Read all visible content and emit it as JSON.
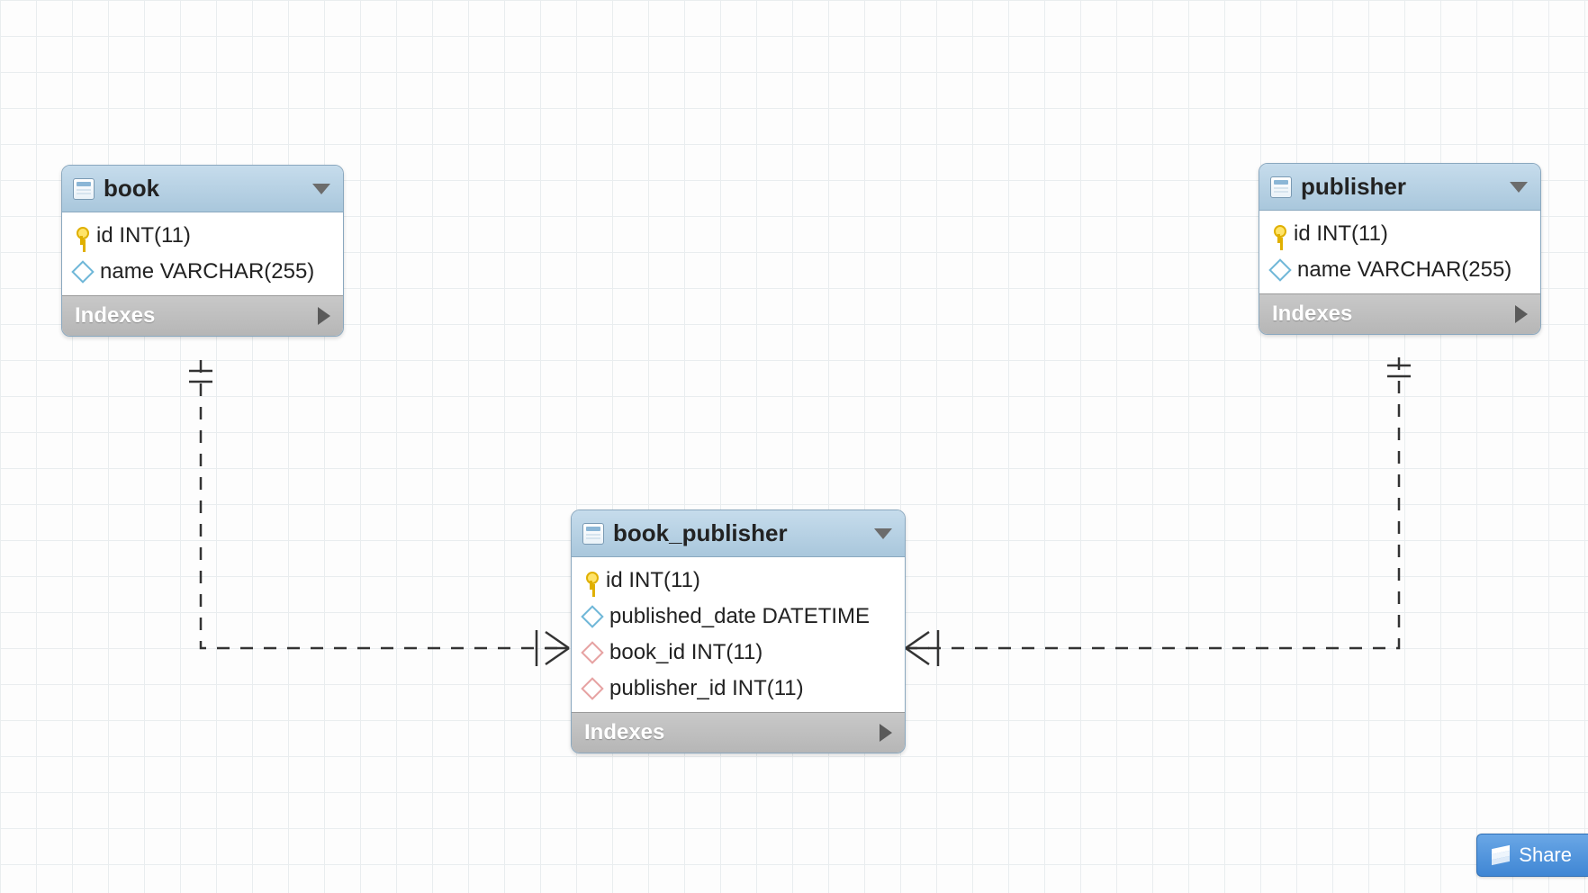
{
  "share_label": "Share",
  "indexes_label": "Indexes",
  "tables": {
    "book": {
      "name": "book",
      "columns": [
        {
          "icon": "key",
          "text": "id INT(11)"
        },
        {
          "icon": "diamond",
          "text": "name VARCHAR(255)"
        }
      ]
    },
    "publisher": {
      "name": "publisher",
      "columns": [
        {
          "icon": "key",
          "text": "id INT(11)"
        },
        {
          "icon": "diamond",
          "text": "name VARCHAR(255)"
        }
      ]
    },
    "book_publisher": {
      "name": "book_publisher",
      "columns": [
        {
          "icon": "key",
          "text": "id INT(11)"
        },
        {
          "icon": "diamond",
          "text": "published_date DATETIME"
        },
        {
          "icon": "diamond-fk",
          "text": "book_id INT(11)"
        },
        {
          "icon": "diamond-fk",
          "text": "publisher_id INT(11)"
        }
      ]
    }
  },
  "relationships": [
    {
      "from": "book",
      "to": "book_publisher",
      "via": "book_id",
      "type": "one-to-many"
    },
    {
      "from": "publisher",
      "to": "book_publisher",
      "via": "publisher_id",
      "type": "one-to-many"
    }
  ]
}
